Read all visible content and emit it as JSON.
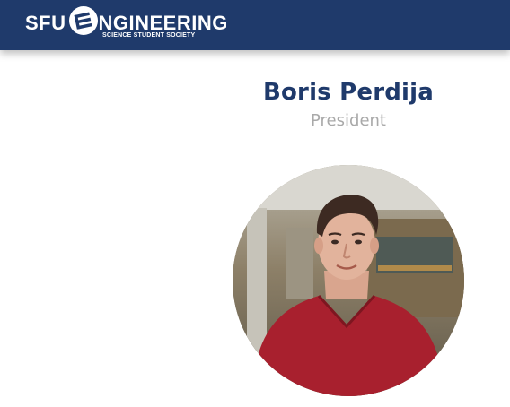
{
  "header": {
    "logo": {
      "prefix": "SFU",
      "rest": "NGINEERING",
      "subtitle": "SCIENCE STUDENT SOCIETY"
    },
    "background": "#1f3a6b"
  },
  "profile": {
    "name": "Boris Perdija",
    "role": "President",
    "name_color": "#1f3a6b",
    "role_color": "#a9a9a9",
    "photo_description_icon": "portrait-photo"
  }
}
